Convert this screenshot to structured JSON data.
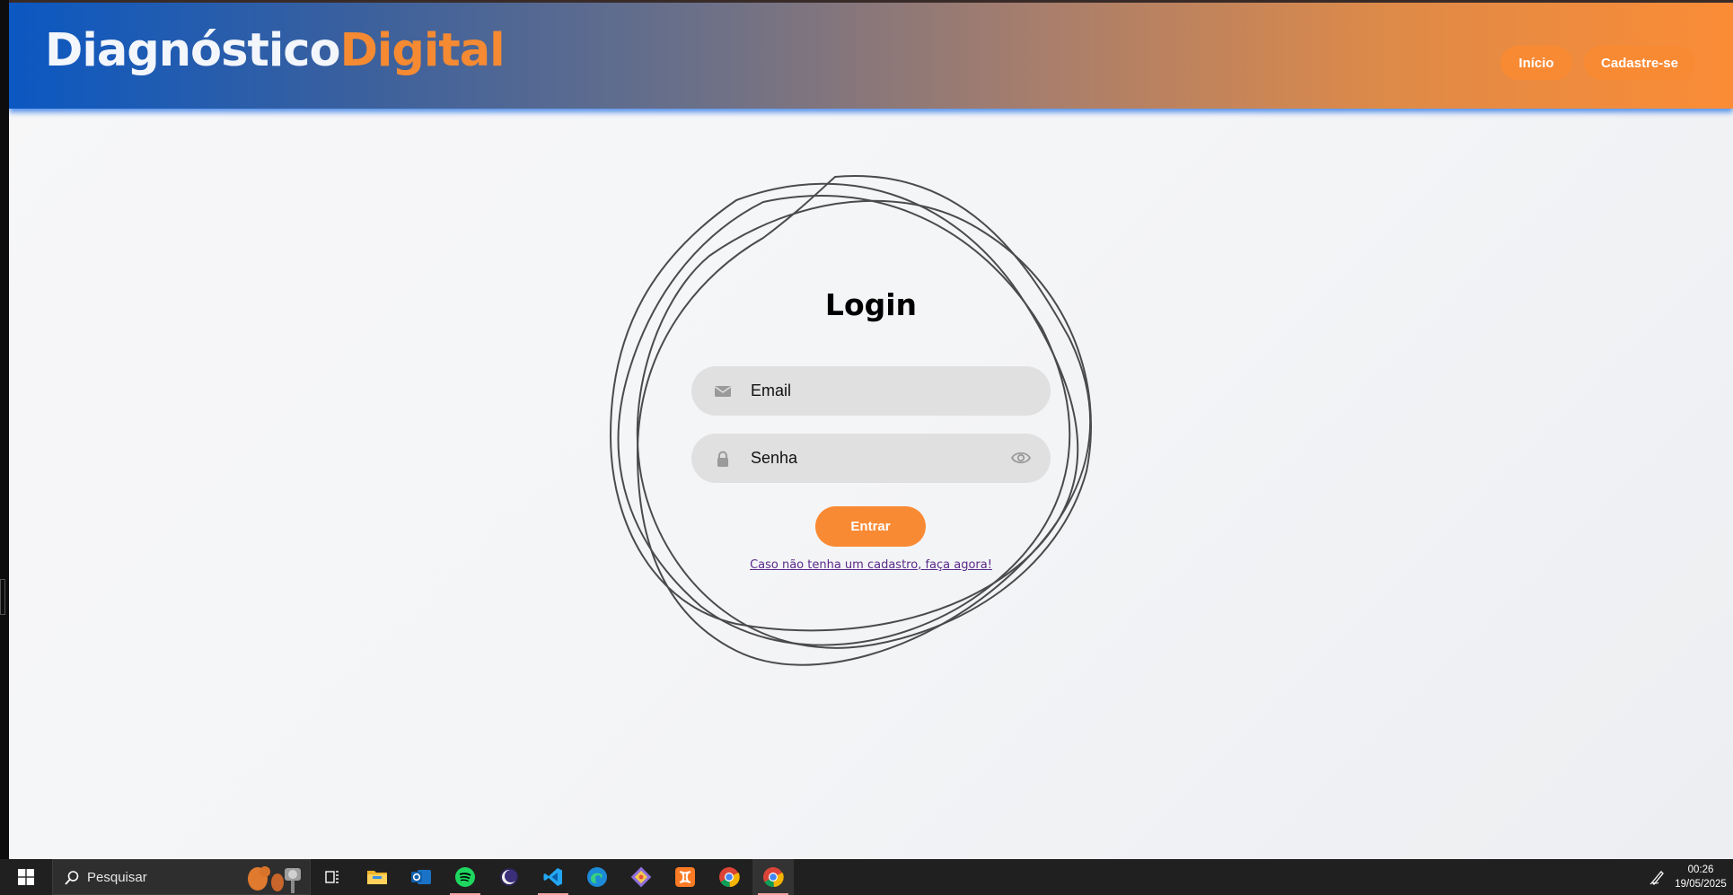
{
  "header": {
    "logo_main": "Diagnóstico",
    "logo_accent": "Digital",
    "nav": [
      {
        "label": "Início"
      },
      {
        "label": "Cadastre-se"
      }
    ]
  },
  "login": {
    "title": "Login",
    "email_placeholder": "Email",
    "password_placeholder": "Senha",
    "submit_label": "Entrar",
    "register_link": "Caso não tenha um cadastro, faça agora!"
  },
  "taskbar": {
    "search_placeholder": "Pesquisar",
    "apps": [
      "task-view-icon",
      "file-explorer-icon",
      "outlook-icon",
      "spotify-icon",
      "eclipse-icon",
      "vscode-icon",
      "edge-icon",
      "git-icon",
      "xampp-icon",
      "chrome-icon",
      "chrome-icon"
    ],
    "time": "00:26",
    "date": "19/05/2025"
  },
  "colors": {
    "accent": "#f98a34",
    "header_start": "#0b58c2",
    "header_end": "#fb8c36",
    "field_bg": "#e0e0e0"
  }
}
